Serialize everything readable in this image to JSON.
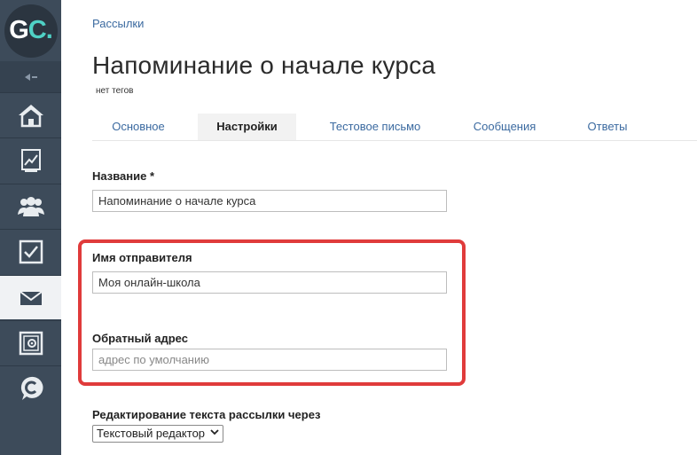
{
  "logo": {
    "part1": "G",
    "part2": "C."
  },
  "sidebar": {
    "items": [
      {
        "name": "home",
        "icon": "home-icon"
      },
      {
        "name": "stats",
        "icon": "chart-icon"
      },
      {
        "name": "users",
        "icon": "users-icon"
      },
      {
        "name": "tasks",
        "icon": "checkbox-icon"
      },
      {
        "name": "mailings",
        "icon": "envelope-icon",
        "active": true
      },
      {
        "name": "safe",
        "icon": "safe-icon"
      },
      {
        "name": "chat",
        "icon": "chat-icon"
      }
    ]
  },
  "breadcrumb": "Рассылки",
  "page": {
    "title": "Напоминание о начале курса",
    "tags": "нет тегов"
  },
  "tabs": [
    {
      "label": "Основное"
    },
    {
      "label": "Настройки",
      "active": true
    },
    {
      "label": "Тестовое письмо"
    },
    {
      "label": "Сообщения"
    },
    {
      "label": "Ответы"
    }
  ],
  "form": {
    "name_label": "Название *",
    "name_value": "Напоминание о начале курса",
    "sender_label": "Имя отправителя",
    "sender_value": "Моя онлайн-школа",
    "reply_label": "Обратный адрес",
    "reply_placeholder": "адрес по умолчанию",
    "editor_label": "Редактирование текста рассылки через",
    "editor_value": "Текстовый редактор"
  },
  "colors": {
    "sidebar": "#3d4b5a",
    "accent_link": "#3b6aa0",
    "logo_accent": "#4fd1c5",
    "highlight": "#e03b3b"
  }
}
